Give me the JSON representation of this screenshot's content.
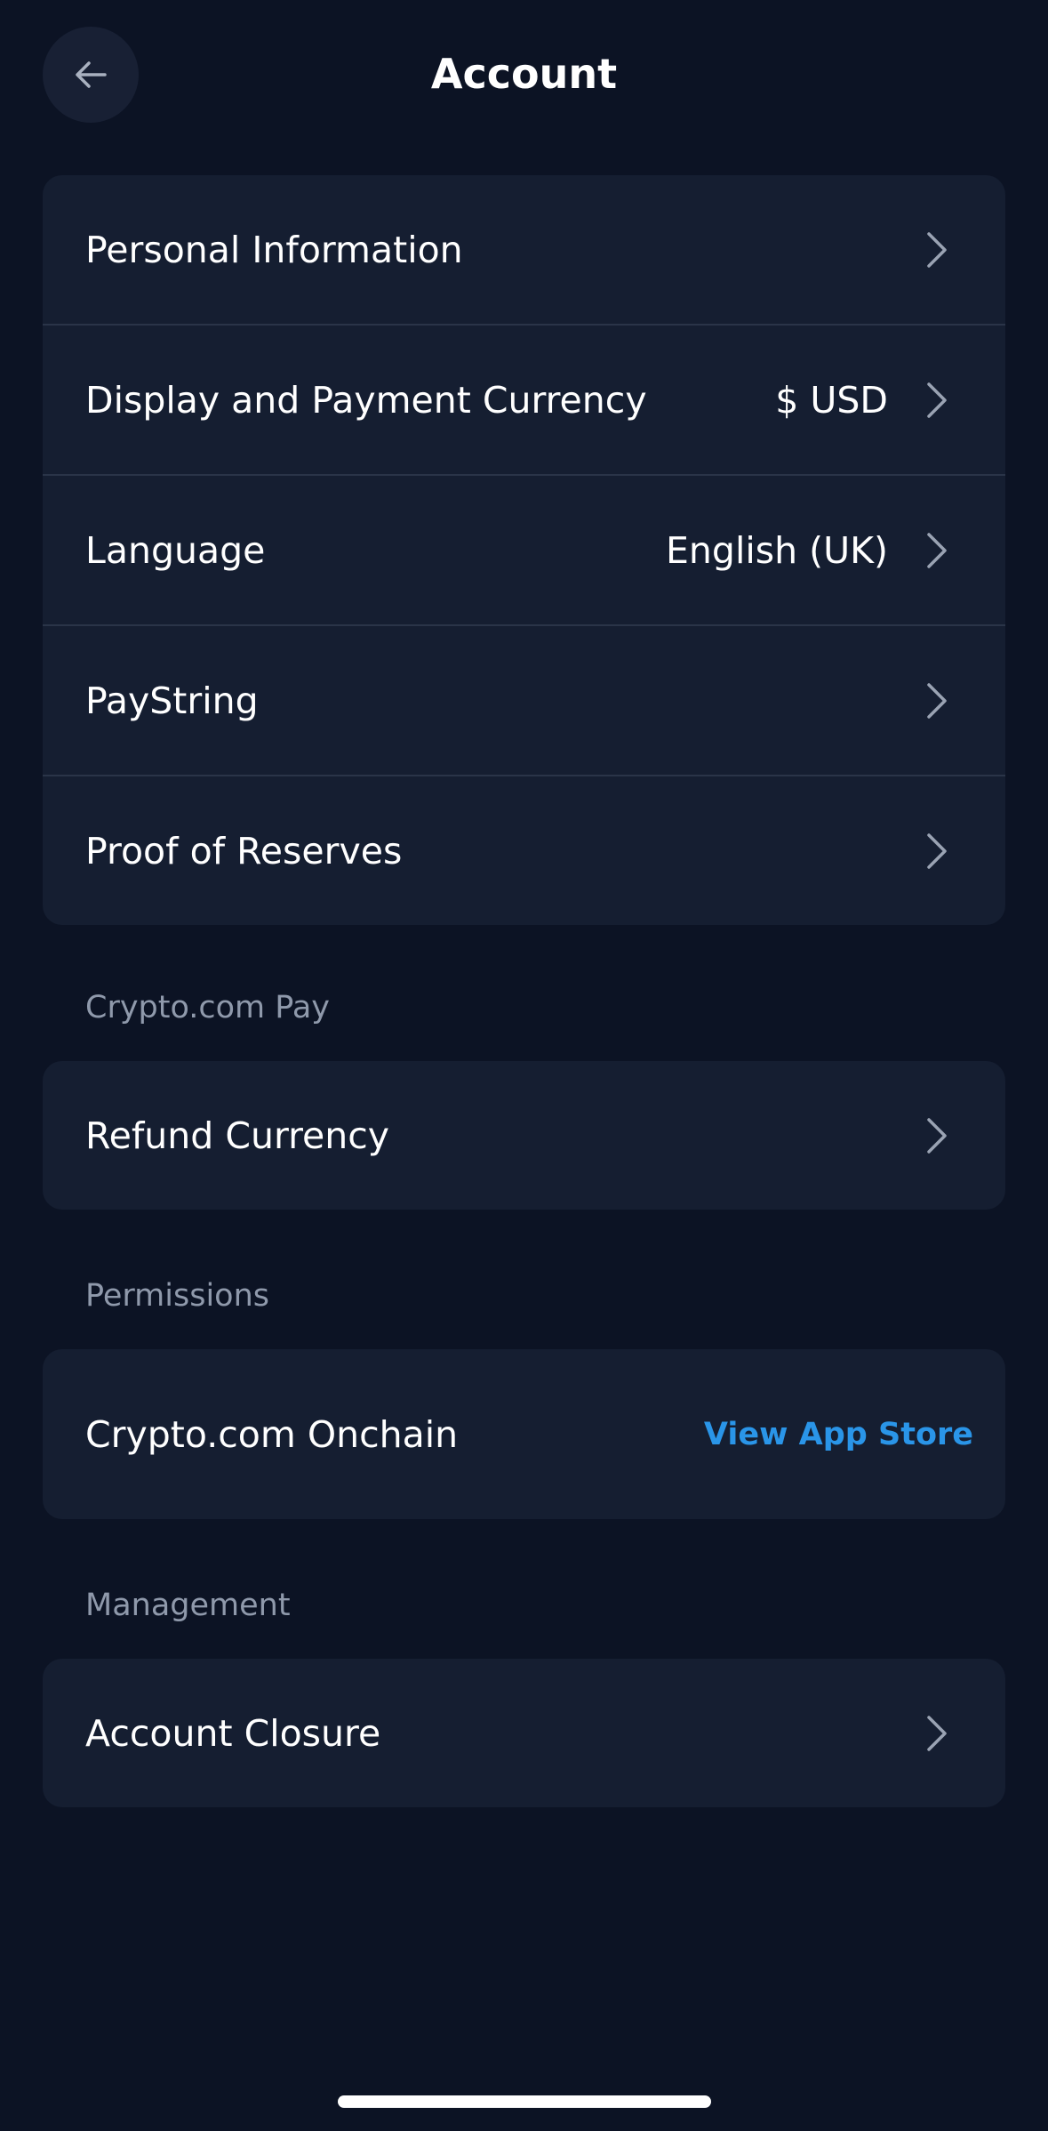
{
  "header": {
    "title": "Account",
    "back_icon": "arrow-left-icon"
  },
  "account_list": {
    "items": [
      {
        "label": "Personal Information",
        "value": ""
      },
      {
        "label": "Display and Payment Currency",
        "value": "$ USD"
      },
      {
        "label": "Language",
        "value": "English (UK)"
      },
      {
        "label": "PayString",
        "value": ""
      },
      {
        "label": "Proof of Reserves",
        "value": ""
      }
    ]
  },
  "crypto_pay": {
    "section_label": "Crypto.com Pay",
    "items": [
      {
        "label": "Refund Currency"
      }
    ]
  },
  "permissions": {
    "section_label": "Permissions",
    "item_label": "Crypto.com Onchain",
    "link_label": "View App Store"
  },
  "management": {
    "section_label": "Management",
    "items": [
      {
        "label": "Account Closure"
      }
    ]
  },
  "colors": {
    "background": "#0c1324",
    "card": "#151e31",
    "divider": "#2a3448",
    "muted_text": "#8f99ab",
    "link": "#2a95e8"
  }
}
